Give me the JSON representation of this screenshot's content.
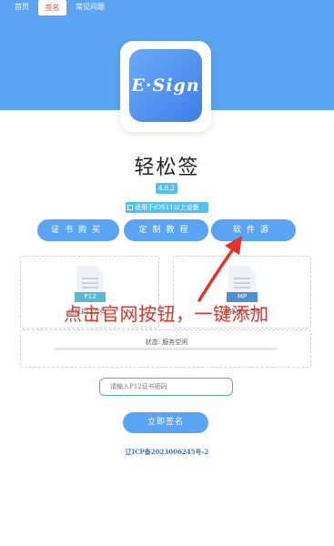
{
  "nav": {
    "items": [
      {
        "label": "首页"
      },
      {
        "label": "签名"
      },
      {
        "label": "常见问题"
      }
    ]
  },
  "app": {
    "logo_text": "E·Sign",
    "title": "轻松签",
    "version": "4.8.2",
    "device_note": "适用于iOS11以上设备"
  },
  "buttons": [
    {
      "label": "证书购买"
    },
    {
      "label": "定制教程"
    },
    {
      "label": "软件源"
    }
  ],
  "uploads": [
    {
      "file_tag": "P12",
      "label": "选择P12文件"
    },
    {
      "file_tag": "MP",
      "label": "选择描述文件"
    }
  ],
  "status": {
    "text": "状态: 服务空闲"
  },
  "password": {
    "placeholder": "请输入P12证书密码"
  },
  "sign_button": {
    "label": "立即签名"
  },
  "footer": {
    "icp": "辽ICP备2023006245号-2"
  },
  "annotation": {
    "text": "点击官网按钮，一键添加"
  },
  "colors": {
    "brand_blue": "#5aa4f3",
    "badge_cyan": "#54c0ee",
    "annotation_red": "#e63327"
  }
}
